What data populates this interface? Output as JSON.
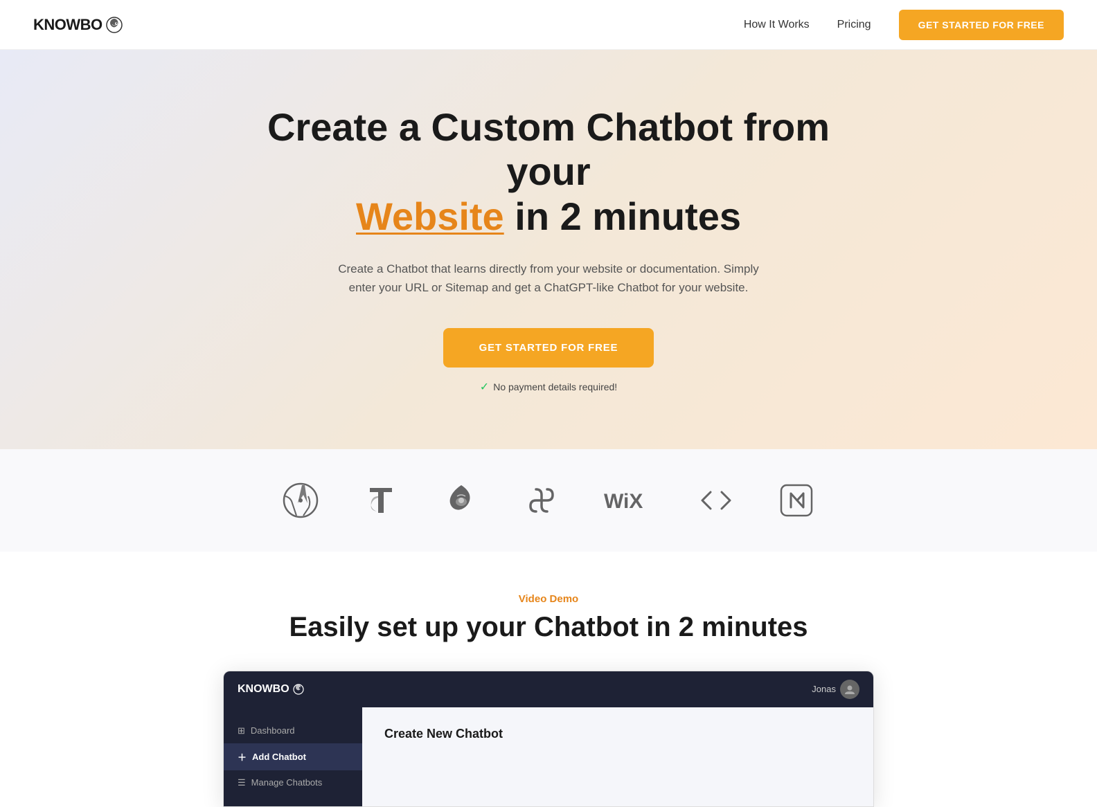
{
  "nav": {
    "logo_text": "KNOWBO",
    "links": [
      {
        "label": "How It Works",
        "id": "how-it-works"
      },
      {
        "label": "Pricing",
        "id": "pricing"
      }
    ],
    "cta_label": "GET STARTED FOR FREE"
  },
  "hero": {
    "title_part1": "Create a Custom Chatbot from your",
    "title_highlight": "Website",
    "title_part2": "in 2 minutes",
    "subtitle": "Create a Chatbot that learns directly from your website or documentation. Simply enter your URL or Sitemap and get a ChatGPT-like Chatbot for your website.",
    "cta_label": "GET STARTED FOR FREE",
    "note": "No payment details required!"
  },
  "logos": [
    {
      "name": "WordPress",
      "symbol": "wordpress"
    },
    {
      "name": "TYPO3",
      "symbol": "typo3"
    },
    {
      "name": "Drupal",
      "symbol": "drupal"
    },
    {
      "name": "Squarespace",
      "symbol": "squarespace"
    },
    {
      "name": "Wix",
      "symbol": "wix"
    },
    {
      "name": "HTML/Code",
      "symbol": "code"
    },
    {
      "name": "Next.js",
      "symbol": "nextjs"
    }
  ],
  "video_section": {
    "label": "Video Demo",
    "title": "Easily set up your Chatbot in 2 minutes"
  },
  "demo_window": {
    "logo": "KNOWBO",
    "user": "Jonas",
    "sidebar_items": [
      {
        "label": "Dashboard",
        "icon": "⊞",
        "active": false
      },
      {
        "label": "Add Chatbot",
        "icon": "＋",
        "active": true
      },
      {
        "label": "Manage Chatbots",
        "icon": "☰",
        "active": false
      }
    ],
    "content_title": "Create New Chatbot"
  }
}
